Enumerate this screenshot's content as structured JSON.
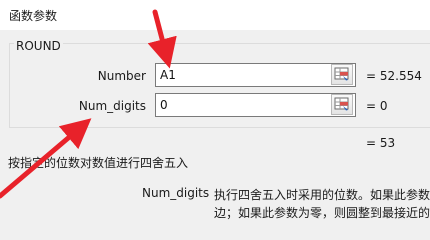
{
  "dialog": {
    "title": "函数参数"
  },
  "function_group": {
    "label": "ROUND"
  },
  "args": [
    {
      "label": "Number",
      "value": "A1",
      "result": "= 52.554"
    },
    {
      "label": "Num_digits",
      "value": "0",
      "result": "= 0"
    }
  ],
  "formula_result": "= 53",
  "function_description": "按指定的位数对数值进行四舍五入",
  "arg_help": {
    "name": "Num_digits",
    "line1": "执行四舍五入时采用的位数。如果此参数",
    "line2": "边；如果此参数为零，则圆整到最接近的"
  },
  "colors": {
    "annotation_arrow": "#e8222a",
    "window_bg": "#f0f0f0"
  }
}
